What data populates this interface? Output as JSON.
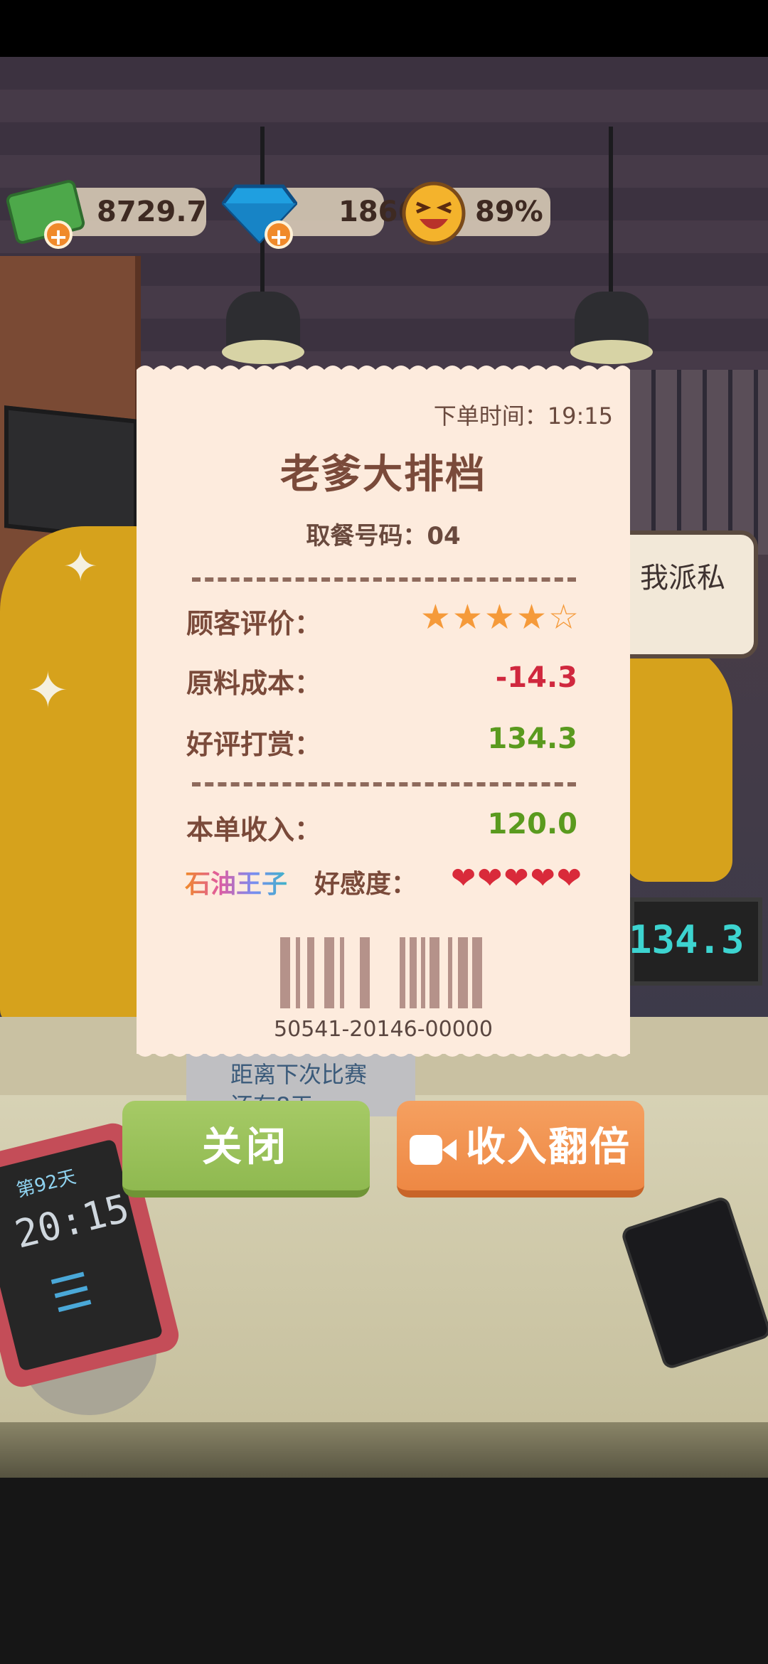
{
  "hud": {
    "cash": "8729.7",
    "diamonds": "1866",
    "satisfaction": "89%"
  },
  "background": {
    "side_sign": "我派私",
    "register_display": "134.3",
    "countdown_text_line1": "距离下次比赛",
    "countdown_text_line2": "还有8天",
    "tablet_day": "第92天",
    "tablet_time": "20:15"
  },
  "receipt": {
    "order_time_label": "下单时间：",
    "order_time": "19:15",
    "shop_name": "老爹大排档",
    "pickup_label": "取餐号码：",
    "pickup_number": "04",
    "rating_label": "顾客评价：",
    "rating_stars": 4,
    "rating_max": 5,
    "cost_label": "原料成本：",
    "cost_value": "-14.3",
    "tip_label": "好评打赏：",
    "tip_value": "134.3",
    "income_label": "本单收入：",
    "income_value": "120.0",
    "customer_name": "石油王子",
    "affection_label": "好感度：",
    "affection_hearts": 5,
    "barcode_number": "50541-20146-00000"
  },
  "buttons": {
    "close_label": "关闭",
    "double_label": "收入翻倍"
  },
  "colors": {
    "negative": "#d0283e",
    "positive": "#5a9a1e",
    "star": "#f59a3a",
    "heart": "#d92a3a",
    "close_button": "#9cc25c",
    "double_button": "#f0924a"
  },
  "icons": {
    "cash": "money-stack-icon",
    "diamond": "diamond-icon",
    "satisfaction": "laughing-face-icon",
    "video": "video-camera-icon",
    "menu": "list-menu-icon"
  }
}
